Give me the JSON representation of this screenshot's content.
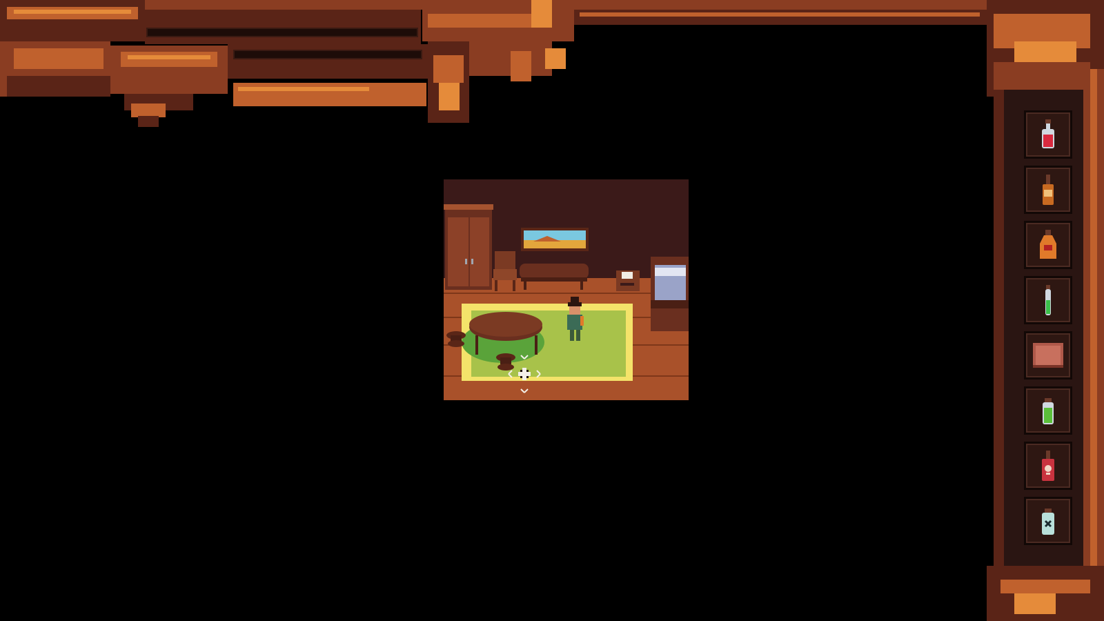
{
  "hud": {
    "health_bar": {
      "fill_fraction": 0.0
    },
    "stamina_bar": {
      "fill_fraction": 0.0
    }
  },
  "inventory": {
    "slots": [
      {
        "icon": "red-potion-icon",
        "color": "#d8293e"
      },
      {
        "icon": "amber-bottle-icon",
        "color": "#c86a21"
      },
      {
        "icon": "orange-flask-icon",
        "color": "#e07a2a"
      },
      {
        "icon": "green-vial-icon",
        "color": "#3bbf4a"
      },
      {
        "icon": "book-icon",
        "color": "#b0594a"
      },
      {
        "icon": "green-jar-icon",
        "color": "#5bbf3a"
      },
      {
        "icon": "skull-bottle-icon",
        "color": "#c9333f"
      },
      {
        "icon": "poison-jar-icon",
        "color": "#b9e0da"
      }
    ]
  },
  "scene": {
    "room": "interior-cabin",
    "cursor": "move-cursor-icon"
  },
  "colors": {
    "frame_dark": "#5a2417",
    "frame_mid": "#8a3d22",
    "frame_light": "#c0612d",
    "frame_highlight": "#e58b3a",
    "rug": "#a8c24a",
    "rug_border": "#f4e36a",
    "floor": "#a9512a",
    "wall": "#3b1a19"
  }
}
